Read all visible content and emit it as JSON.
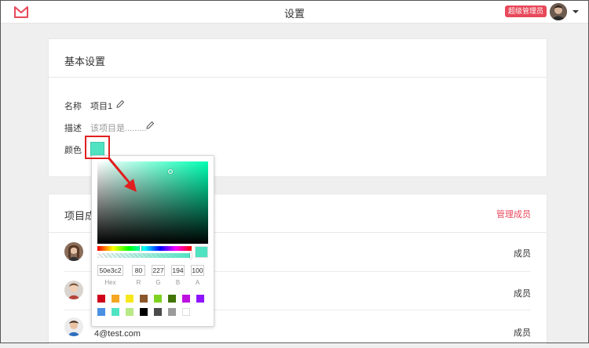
{
  "header": {
    "title": "设置",
    "role_badge": "超级管理员"
  },
  "basic_settings": {
    "title": "基本设置",
    "name_label": "名称",
    "name_value": "项目1",
    "desc_label": "描述",
    "desc_placeholder": "该项目是.........",
    "color_label": "颜色",
    "color_value": "#50e3c2"
  },
  "members": {
    "title": "项目成",
    "manage_link": "管理成员",
    "rows": [
      {
        "email": "",
        "role": "成员"
      },
      {
        "email": "",
        "role": "成员"
      },
      {
        "email": "4@test.com",
        "role": "成员"
      }
    ]
  },
  "color_picker": {
    "hex": "50e3c2",
    "r": "80",
    "g": "227",
    "b": "194",
    "a": "100",
    "hex_label": "Hex",
    "r_label": "R",
    "g_label": "G",
    "b_label": "B",
    "a_label": "A",
    "presets": [
      "#d0021b",
      "#f5a623",
      "#f8e71c",
      "#8b572a",
      "#7ed321",
      "#417505",
      "#bd10e0",
      "#9013fe",
      "#4a90e2",
      "#50e3c2",
      "#b8e986",
      "#000000",
      "#4a4a4a",
      "#9b9b9b",
      "#ffffff"
    ]
  },
  "colors": {
    "accent": "#e8485a",
    "annotation": "#e02020"
  }
}
